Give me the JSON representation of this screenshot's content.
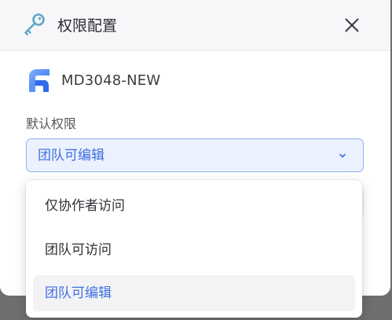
{
  "dialog": {
    "title": "权限配置",
    "icon": "key-icon",
    "close_icon": "close-icon"
  },
  "project": {
    "logo_icon": "project-logo-icon",
    "name": "MD3048-NEW"
  },
  "permission": {
    "label": "默认权限",
    "selected_value": "团队可编辑",
    "options": [
      {
        "label": "仅协作者访问",
        "selected": false
      },
      {
        "label": "团队可访问",
        "selected": false
      },
      {
        "label": "团队可编辑",
        "selected": true
      }
    ]
  },
  "colors": {
    "accent": "#3d6fe0",
    "select_background": "#ebf1fe",
    "select_border": "#8fb2f4",
    "overlay": "#6f6f71",
    "key_icon": "#5fa6c8"
  }
}
